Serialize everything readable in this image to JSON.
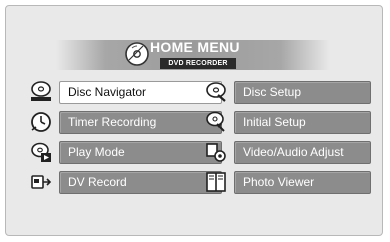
{
  "header": {
    "title": "HOME MENU",
    "subtitle": "DVD RECORDER"
  },
  "menu": {
    "left": [
      {
        "label": "Disc Navigator",
        "icon": "disc-navigator-icon",
        "selected": true
      },
      {
        "label": "Timer Recording",
        "icon": "clock-icon",
        "selected": false
      },
      {
        "label": "Play Mode",
        "icon": "play-mode-icon",
        "selected": false
      },
      {
        "label": "DV Record",
        "icon": "dv-record-icon",
        "selected": false
      }
    ],
    "right": [
      {
        "label": "Disc Setup",
        "icon": "disc-setup-icon"
      },
      {
        "label": "Initial Setup",
        "icon": "initial-setup-icon"
      },
      {
        "label": "Video/Audio Adjust",
        "icon": "video-audio-adjust-icon"
      },
      {
        "label": "Photo Viewer",
        "icon": "photo-viewer-icon"
      }
    ]
  },
  "colors": {
    "background": "#e9e9e9",
    "button": "#8c8c8c",
    "selected_button": "#ffffff"
  }
}
